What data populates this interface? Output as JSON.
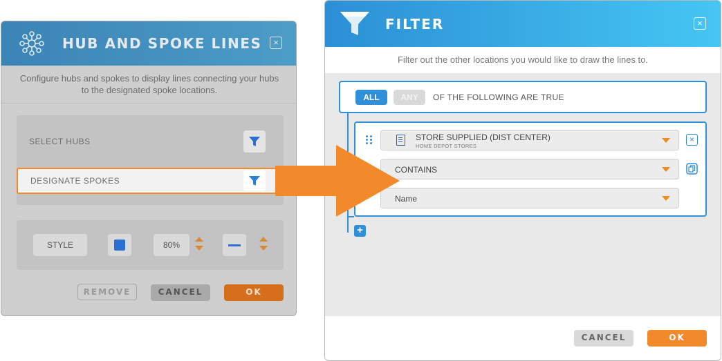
{
  "hub_dialog": {
    "title": "HUB AND SPOKE LINES",
    "close_label": "×",
    "description": "Configure hubs and spokes to display lines connecting your hubs to the designated spoke locations.",
    "rows": {
      "select_hubs": "SELECT HUBS",
      "designate_spokes": "DESIGNATE SPOKES"
    },
    "style": {
      "label": "STYLE",
      "color": "#2a6fd1",
      "opacity": "80%"
    },
    "buttons": {
      "remove": "REMOVE",
      "cancel": "CANCEL",
      "ok": "OK"
    }
  },
  "filter_dialog": {
    "title": "FILTER",
    "close_label": "×",
    "description": "Filter out the other locations you would like to draw the lines to.",
    "match_toggle": {
      "all": "ALL",
      "any": "ANY",
      "selected": "ALL",
      "suffix": "OF THE FOLLOWING ARE TRUE"
    },
    "rule": {
      "field": "STORE SUPPLIED (DIST CENTER)",
      "field_source": "HOME DEPOT STORES",
      "operator": "CONTAINS",
      "value": "Name"
    },
    "remove_rule_label": "×",
    "add_rule_label": "+",
    "buttons": {
      "cancel": "CANCEL",
      "ok": "OK"
    }
  },
  "colors": {
    "accent_blue": "#2f8fd8",
    "accent_orange": "#f08a24",
    "header_gradient_start": "#2c8fd6",
    "header_gradient_end": "#45c6f3"
  }
}
